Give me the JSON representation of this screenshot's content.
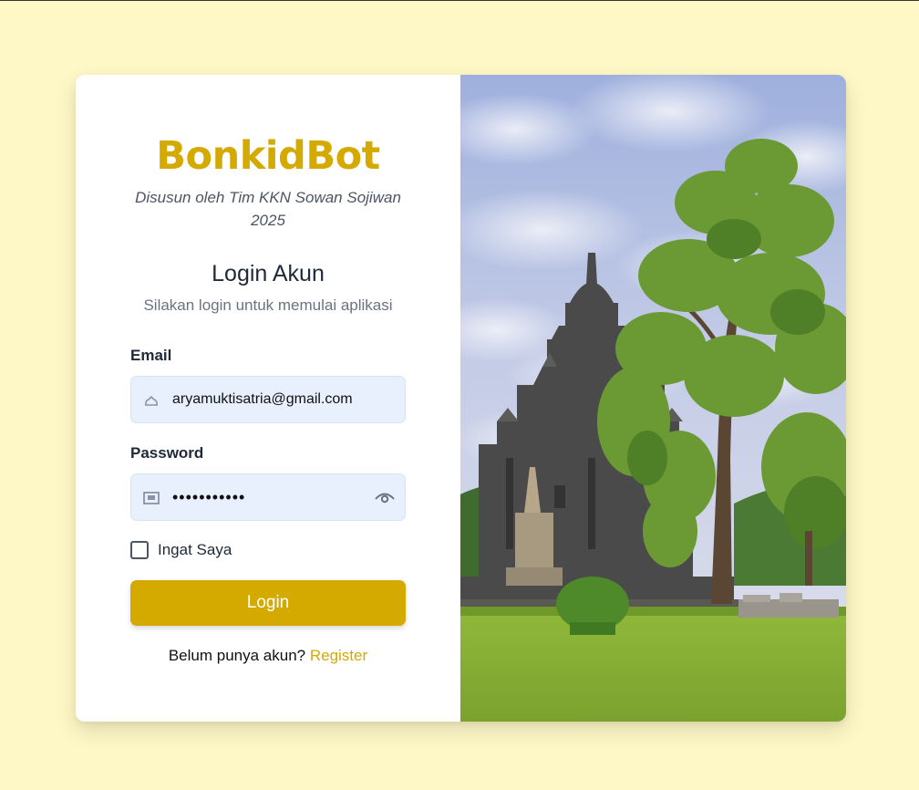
{
  "brand": {
    "name": "BonkidBot",
    "credit": "Disusun oleh Tim KKN Sowan Sojiwan 2025"
  },
  "login": {
    "title": "Login Akun",
    "description": "Silakan login untuk memulai aplikasi",
    "email_label": "Email",
    "email_value": "aryamuktisatria@gmail.com",
    "password_label": "Password",
    "password_value": "•••••••••••",
    "remember_label": "Ingat Saya",
    "button_label": "Login",
    "register_prompt": "Belum punya akun?",
    "register_link": "Register"
  },
  "colors": {
    "background": "#fef8c6",
    "accent": "#d4aa00",
    "input_bg": "#e8f0fe"
  },
  "icons": {
    "email": "user-icon",
    "password": "lock-icon",
    "toggle": "eye-icon"
  }
}
